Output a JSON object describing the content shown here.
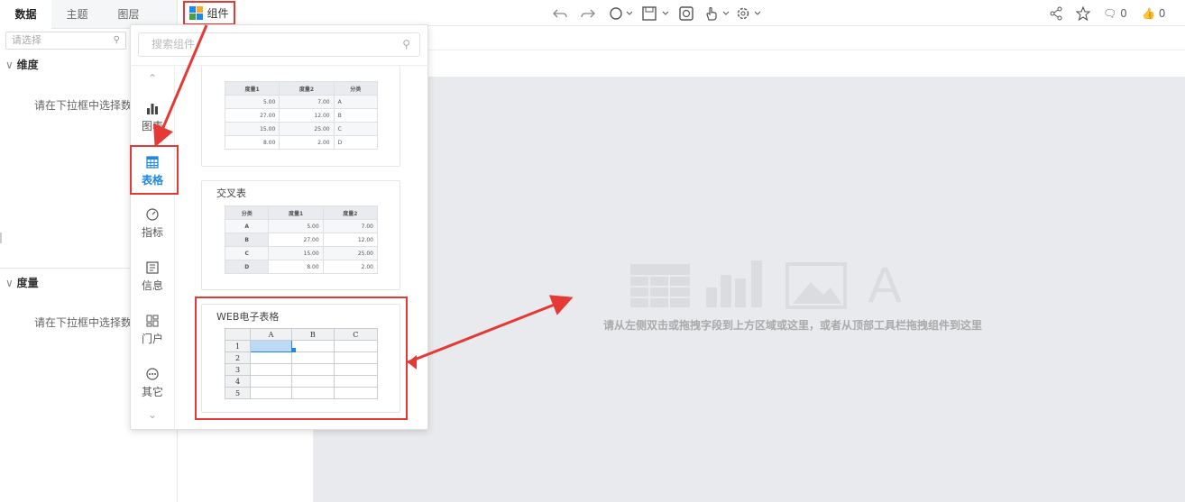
{
  "left_panel": {
    "tabs": [
      "数据",
      "主题",
      "图层"
    ],
    "select_placeholder": "请选择",
    "dimension_title": "维度",
    "measure_title": "度量",
    "dimension_hint": "请在下拉框中选择数",
    "measure_hint": "请在下拉框中选择数"
  },
  "toolbar": {
    "component_label": "组件",
    "comments_count": "0",
    "likes_count": "0"
  },
  "popup": {
    "search_placeholder": "搜索组件",
    "categories": [
      "图表",
      "表格",
      "指标",
      "信息",
      "门户",
      "其它"
    ],
    "detail_table": {
      "headers": [
        "度量1",
        "度量2",
        "分类"
      ],
      "rows": [
        [
          "5.00",
          "7.00",
          "A"
        ],
        [
          "27.00",
          "12.00",
          "B"
        ],
        [
          "15.00",
          "25.00",
          "C"
        ],
        [
          "8.00",
          "2.00",
          "D"
        ]
      ]
    },
    "cross_table": {
      "title": "交叉表",
      "headers": [
        "分类",
        "度量1",
        "度量2"
      ],
      "rows": [
        [
          "A",
          "5.00",
          "7.00"
        ],
        [
          "B",
          "27.00",
          "12.00"
        ],
        [
          "C",
          "15.00",
          "25.00"
        ],
        [
          "D",
          "8.00",
          "2.00"
        ]
      ]
    },
    "web_sheet": {
      "title": "WEB电子表格",
      "columns": [
        "A",
        "B",
        "C"
      ],
      "rows": [
        "1",
        "2",
        "3",
        "4",
        "5"
      ]
    }
  },
  "canvas": {
    "hint": "请从左侧双击或拖拽字段到上方区域或这里，或者从顶部工具栏拖拽组件到这里",
    "placeholder_letter": "A"
  },
  "colors": {
    "highlight": "#e53935",
    "accent": "#1e88e5"
  }
}
